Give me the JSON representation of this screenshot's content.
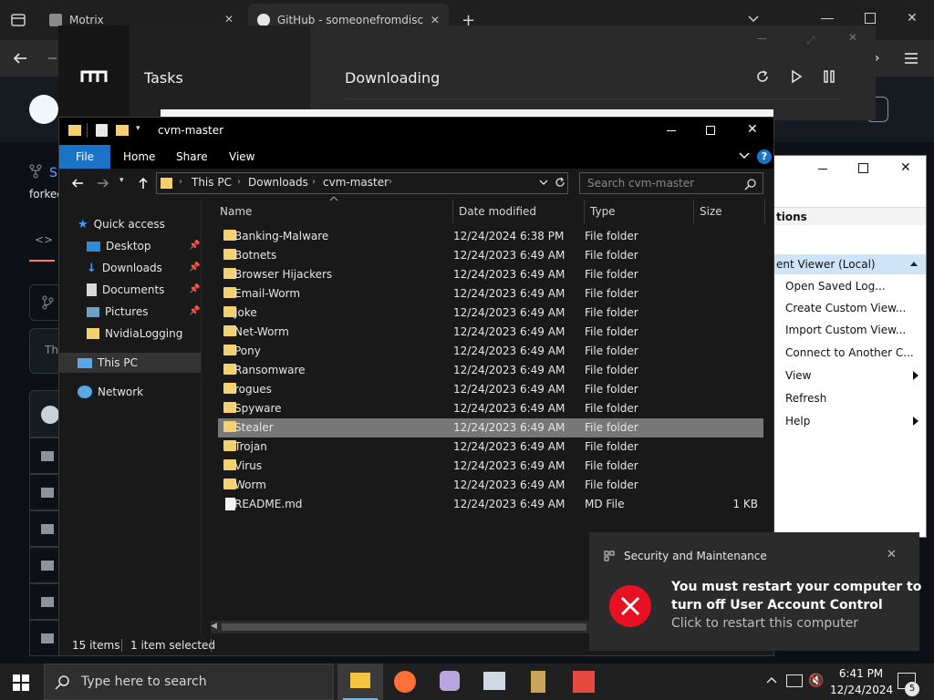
{
  "browser": {
    "tabs": [
      {
        "label": "Motrix"
      },
      {
        "label": "GitHub - someonefromdiscord"
      }
    ]
  },
  "github": {
    "side_text_s": "S",
    "forked_text": "forked",
    "banner_text": "Th"
  },
  "motrix": {
    "tasks_label": "Tasks",
    "downloading_label": "Downloading"
  },
  "explorer": {
    "title": "cvm-master",
    "ribbon_tabs": [
      "File",
      "Home",
      "Share",
      "View"
    ],
    "breadcrumb": [
      "This PC",
      "Downloads",
      "cvm-master"
    ],
    "search_placeholder": "Search cvm-master",
    "columns": [
      "Name",
      "Date modified",
      "Type",
      "Size"
    ],
    "nav": [
      {
        "label": "Quick access",
        "icon": "star-icon"
      },
      {
        "label": "Desktop",
        "icon": "desktop-icon",
        "pinned": true
      },
      {
        "label": "Downloads",
        "icon": "download-arrow-icon",
        "pinned": true
      },
      {
        "label": "Documents",
        "icon": "document-icon",
        "pinned": true
      },
      {
        "label": "Pictures",
        "icon": "pictures-icon",
        "pinned": true
      },
      {
        "label": "NvidiaLogging",
        "icon": "folder-icon"
      },
      {
        "label": "This PC",
        "icon": "computer-icon"
      },
      {
        "label": "Network",
        "icon": "network-icon"
      }
    ],
    "files": [
      {
        "name": "Banking-Malware",
        "date": "12/24/2024 6:38 PM",
        "type": "File folder",
        "size": ""
      },
      {
        "name": "Botnets",
        "date": "12/24/2023 6:49 AM",
        "type": "File folder",
        "size": ""
      },
      {
        "name": "Browser Hijackers",
        "date": "12/24/2023 6:49 AM",
        "type": "File folder",
        "size": ""
      },
      {
        "name": "Email-Worm",
        "date": "12/24/2023 6:49 AM",
        "type": "File folder",
        "size": ""
      },
      {
        "name": "Joke",
        "date": "12/24/2023 6:49 AM",
        "type": "File folder",
        "size": ""
      },
      {
        "name": "Net-Worm",
        "date": "12/24/2023 6:49 AM",
        "type": "File folder",
        "size": ""
      },
      {
        "name": "Pony",
        "date": "12/24/2023 6:49 AM",
        "type": "File folder",
        "size": ""
      },
      {
        "name": "Ransomware",
        "date": "12/24/2023 6:49 AM",
        "type": "File folder",
        "size": ""
      },
      {
        "name": "rogues",
        "date": "12/24/2023 6:49 AM",
        "type": "File folder",
        "size": ""
      },
      {
        "name": "Spyware",
        "date": "12/24/2023 6:49 AM",
        "type": "File folder",
        "size": ""
      },
      {
        "name": "Stealer",
        "date": "12/24/2023 6:49 AM",
        "type": "File folder",
        "size": "",
        "selected": true
      },
      {
        "name": "Trojan",
        "date": "12/24/2023 6:49 AM",
        "type": "File folder",
        "size": ""
      },
      {
        "name": "Virus",
        "date": "12/24/2023 6:49 AM",
        "type": "File folder",
        "size": ""
      },
      {
        "name": "Worm",
        "date": "12/24/2023 6:49 AM",
        "type": "File folder",
        "size": ""
      },
      {
        "name": "README.md",
        "date": "12/24/2023 6:49 AM",
        "type": "MD File",
        "size": "1 KB",
        "is_file": true
      }
    ],
    "status_items": "15 items",
    "status_selected": "1 item selected"
  },
  "event_viewer": {
    "section_title": "tions",
    "selected_item": "ent Viewer (Local)",
    "items": [
      {
        "label": "Open Saved Log..."
      },
      {
        "label": "Create Custom View..."
      },
      {
        "label": "Import Custom View..."
      },
      {
        "label": "Connect to Another C..."
      },
      {
        "label": "View"
      },
      {
        "label": "Refresh"
      },
      {
        "label": "Help"
      }
    ]
  },
  "toast": {
    "app": "Security and Maintenance",
    "title_line1": "You must restart your computer to",
    "title_line2": "turn off User Account Control",
    "body": "Click to restart this computer"
  },
  "taskbar": {
    "search_placeholder": "Type here to search",
    "time": "6:41 PM",
    "date": "12/24/2024",
    "notification_count": "5"
  },
  "colors": {
    "selected_row": "#777777",
    "folder": "#f4d06f",
    "toast_error": "#e81123",
    "accent_blue": "#0078d7"
  }
}
